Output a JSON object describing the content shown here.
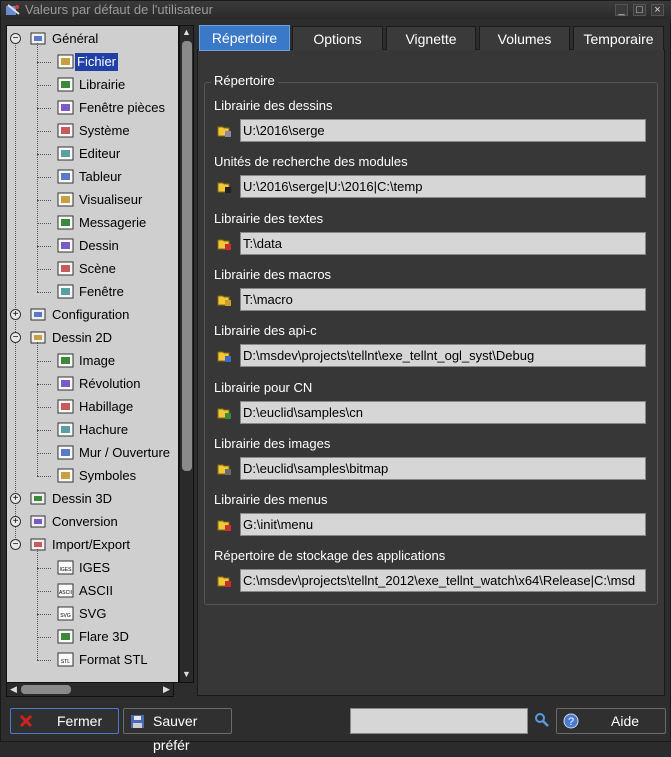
{
  "window": {
    "title": "Valeurs par défaut de l'utilisateur",
    "controls": [
      "_",
      "□",
      "×"
    ]
  },
  "tree": {
    "items": [
      {
        "label": "Général",
        "level": 0,
        "expanded": true,
        "icon": "settings-cog-icon"
      },
      {
        "label": "Fichier",
        "level": 1,
        "selected": true,
        "icon": "folder-icon"
      },
      {
        "label": "Librairie",
        "level": 1,
        "icon": "book-icon"
      },
      {
        "label": "Fenêtre pièces",
        "level": 1,
        "icon": "parts-window-icon"
      },
      {
        "label": "Système",
        "level": 1,
        "icon": "computer-icon"
      },
      {
        "label": "Editeur",
        "level": 1,
        "icon": "editor-icon"
      },
      {
        "label": "Tableur",
        "level": 1,
        "icon": "spreadsheet-icon"
      },
      {
        "label": "Visualiseur",
        "level": 1,
        "icon": "viewer-icon"
      },
      {
        "label": "Messagerie",
        "level": 1,
        "icon": "mail-icon"
      },
      {
        "label": "Dessin",
        "level": 1,
        "icon": "drawing-icon"
      },
      {
        "label": "Scène",
        "level": 1,
        "icon": "scene-icon"
      },
      {
        "label": "Fenêtre",
        "level": 1,
        "icon": "window-icon"
      },
      {
        "label": "Configuration",
        "level": 0,
        "expanded": false,
        "icon": "tools-icon"
      },
      {
        "label": "Dessin 2D",
        "level": 0,
        "expanded": true,
        "icon": "drawing-2d-icon"
      },
      {
        "label": "Image",
        "level": 1,
        "icon": "image-icon"
      },
      {
        "label": "Révolution",
        "level": 1,
        "icon": "revolution-icon"
      },
      {
        "label": "Habillage",
        "level": 1,
        "icon": "dimension-icon"
      },
      {
        "label": "Hachure",
        "level": 1,
        "icon": "hatch-icon"
      },
      {
        "label": "Mur / Ouverture",
        "level": 1,
        "icon": "wall-icon"
      },
      {
        "label": "Symboles",
        "level": 1,
        "icon": "symbols-icon"
      },
      {
        "label": "Dessin 3D",
        "level": 0,
        "expanded": false,
        "icon": "drawing-3d-icon"
      },
      {
        "label": "Conversion",
        "level": 0,
        "expanded": false,
        "icon": "conversion-icon"
      },
      {
        "label": "Import/Export",
        "level": 0,
        "expanded": true,
        "icon": "import-export-icon"
      },
      {
        "label": "IGES",
        "level": 1,
        "icon": "iges-icon",
        "badge": "IGES"
      },
      {
        "label": "ASCII",
        "level": 1,
        "icon": "ascii-icon",
        "badge": "ASCII"
      },
      {
        "label": "SVG",
        "level": 1,
        "icon": "svg-icon",
        "badge": "SVG"
      },
      {
        "label": "Flare 3D",
        "level": 1,
        "icon": "flare-icon"
      },
      {
        "label": "Format STL",
        "level": 1,
        "icon": "stl-icon",
        "badge": "STL"
      }
    ]
  },
  "tabs": [
    {
      "label": "Répertoire",
      "active": true
    },
    {
      "label": "Options"
    },
    {
      "label": "Vignette"
    },
    {
      "label": "Volumes"
    },
    {
      "label": "Temporaire"
    }
  ],
  "group": {
    "title": "Répertoire"
  },
  "fields": [
    {
      "label": "Librairie des dessins",
      "value": "U:\\2016\\serge",
      "icon": "drawings-folder-icon"
    },
    {
      "label": "Unités de recherche des modules",
      "value": "U:\\2016\\serge|U:\\2016|C:\\temp",
      "icon": "modules-folder-icon"
    },
    {
      "label": "Librairie des textes",
      "value": "T:\\data",
      "icon": "texts-folder-icon"
    },
    {
      "label": "Librairie des macros",
      "value": "T:\\macro",
      "icon": "macros-folder-icon"
    },
    {
      "label": "Librairie des api-c",
      "value": "D:\\msdev\\projects\\tellnt\\exe_tellnt_ogl_syst\\Debug",
      "icon": "api-folder-icon"
    },
    {
      "label": "Librairie pour CN",
      "value": "D:\\euclid\\samples\\cn",
      "icon": "cn-folder-icon"
    },
    {
      "label": "Librairie des images",
      "value": "D:\\euclid\\samples\\bitmap",
      "icon": "images-folder-icon"
    },
    {
      "label": "Librairie des menus",
      "value": "G:\\init\\menu",
      "icon": "menus-folder-icon"
    },
    {
      "label": "Répertoire de stockage des applications",
      "value": "C:\\msdev\\projects\\tellnt_2012\\exe_tellnt_watch\\x64\\Release|C:\\msd",
      "icon": "apps-folder-icon"
    }
  ],
  "bottom": {
    "close_label": "Fermer",
    "save_label": "Sauver préfér",
    "search_value": "",
    "help_label": "Aide"
  },
  "colors": {
    "accent": "#3a78c8",
    "selection": "#2040a8",
    "close_x": "#d02020"
  }
}
